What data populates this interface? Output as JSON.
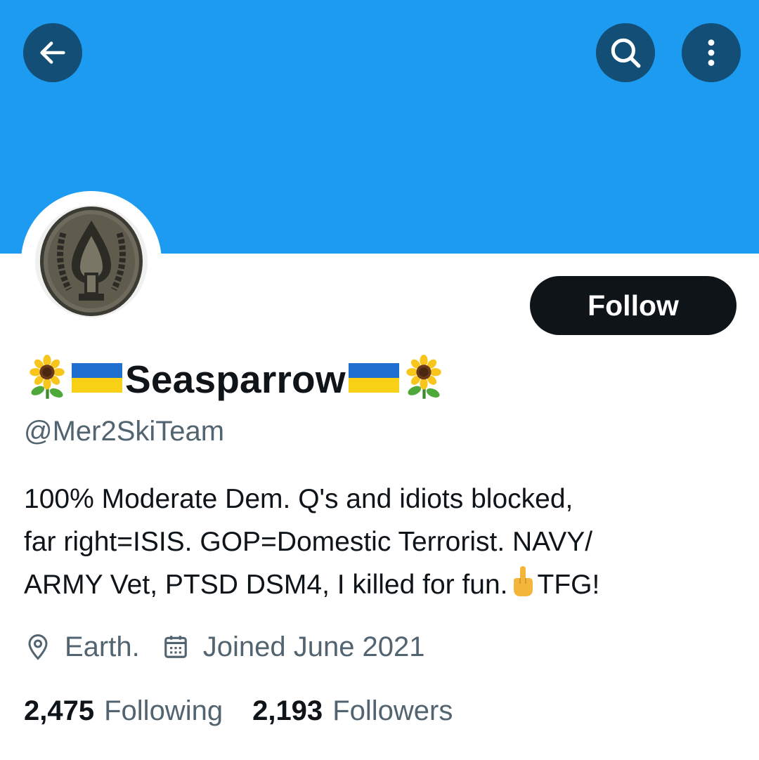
{
  "header": {
    "back_icon": "arrow-left-icon",
    "search_icon": "search-icon",
    "more_icon": "more-vertical-icon",
    "banner_color": "#1d9bf0",
    "button_color": "#124e75"
  },
  "profile": {
    "avatar": "military-badge-avatar",
    "display_name": "Seasparrow",
    "name_prefix_emojis": [
      "sunflower",
      "ukraine-flag"
    ],
    "name_suffix_emojis": [
      "ukraine-flag",
      "sunflower"
    ],
    "handle": "@Mer2SkiTeam",
    "follow_label": "Follow",
    "bio_lines": [
      "100% Moderate Dem. Q's and idiots blocked,",
      "far right=ISIS. GOP=Domestic Terrorist. NAVY/",
      "ARMY Vet, PTSD DSM4, I killed for fun."
    ],
    "bio_emoji": "middle-finger",
    "bio_tail": "TFG!",
    "location": "Earth.",
    "joined": "Joined June 2021",
    "following_count": "2,475",
    "following_label": "Following",
    "followers_count": "2,193",
    "followers_label": "Followers"
  },
  "colors": {
    "text_primary": "#0f1419",
    "text_secondary": "#536471",
    "follow_bg": "#0f1419"
  }
}
